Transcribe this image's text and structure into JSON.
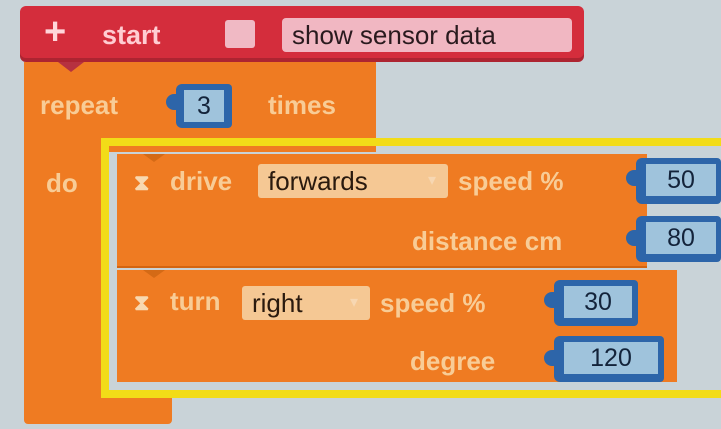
{
  "start_block": {
    "plus_symbol": "+",
    "label": "start",
    "checkbox_checked": false,
    "button_label": "show sensor data"
  },
  "repeat_block": {
    "repeat_label": "repeat",
    "count": "3",
    "times_label": "times",
    "do_label": "do"
  },
  "drive_block": {
    "label": "drive",
    "direction": "forwards",
    "speed_label": "speed %",
    "speed": "50",
    "distance_label": "distance cm",
    "distance": "80"
  },
  "turn_block": {
    "label": "turn",
    "direction": "right",
    "speed_label": "speed %",
    "speed": "30",
    "degree_label": "degree",
    "degree": "120"
  },
  "colors": {
    "event_block": "#d42d3c",
    "control_block": "#ef7b22",
    "number_slot": "#2d65a9",
    "highlight": "#f2dc18"
  }
}
